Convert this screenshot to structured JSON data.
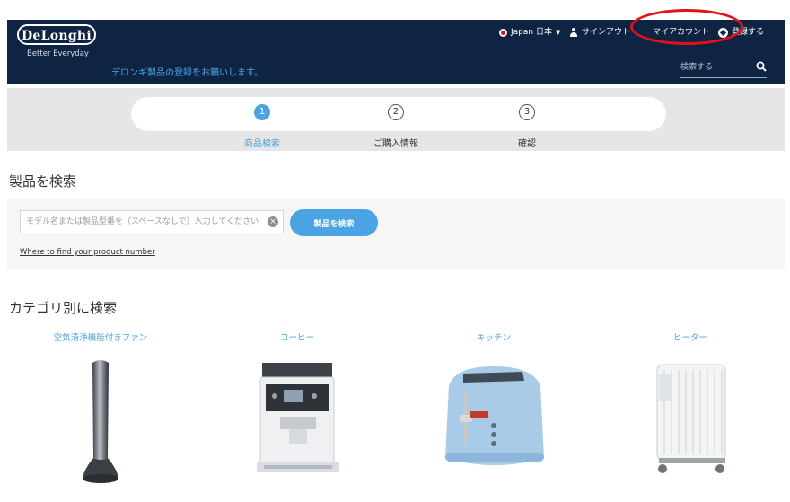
{
  "header": {
    "logo": "DeLonghi",
    "tagline": "Better Everyday",
    "registration_message": "デロンギ製品の登録をお願いします。",
    "nav": {
      "region": "Japan 日本",
      "signout": "サインアウト",
      "my_account": "マイアカウント",
      "register": "登録する"
    },
    "search_placeholder": "検索する"
  },
  "steps": [
    {
      "number": "1",
      "label": "商品検索",
      "active": true
    },
    {
      "number": "2",
      "label": "ご購入情報",
      "active": false
    },
    {
      "number": "3",
      "label": "確認",
      "active": false
    }
  ],
  "product_search": {
    "title": "製品を検索",
    "input_placeholder": "モデル名または製品型番を（スペースなしで）入力してください",
    "button_label": "製品を検索",
    "help_link": "Where to find your product number"
  },
  "categories": {
    "title": "カテゴリ別に検索",
    "items": [
      {
        "label": "空気清浄機能付きファン",
        "icon": "tower-fan-image"
      },
      {
        "label": "コーヒー",
        "icon": "espresso-machine-image"
      },
      {
        "label": "キッチン",
        "icon": "toaster-image"
      },
      {
        "label": "ヒーター",
        "icon": "oil-heater-image"
      }
    ]
  },
  "colors": {
    "header_bg": "#0f2443",
    "accent": "#4aa3e2",
    "highlight": "#e3101a"
  }
}
